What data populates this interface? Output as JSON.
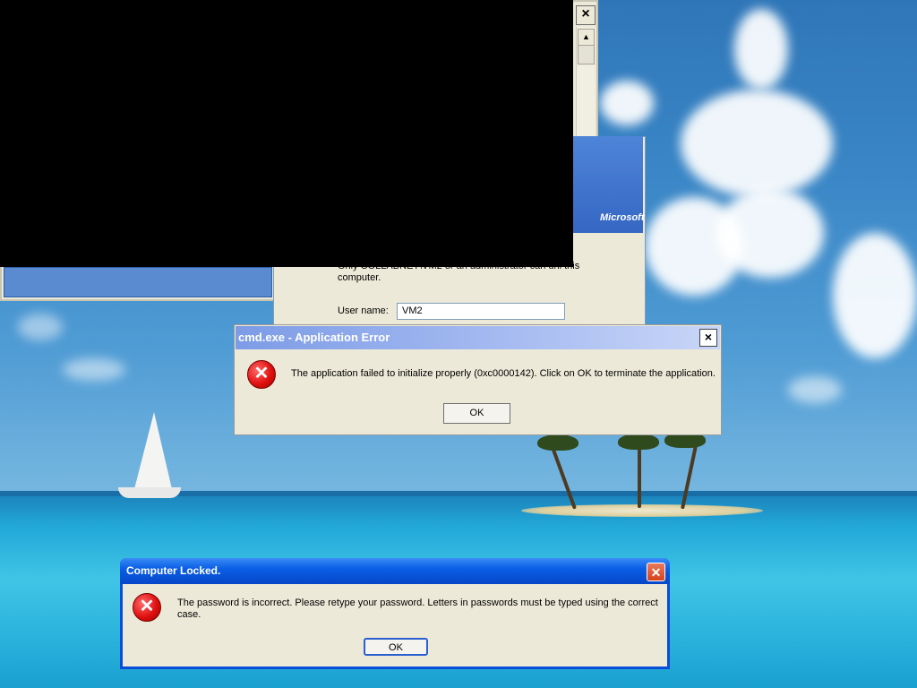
{
  "background_window": {
    "close_glyph": "×",
    "scroll_up": "▲",
    "scroll_down": "▼"
  },
  "logon_dialog": {
    "brand": "Microsoft",
    "message_fragment": "Only COLLABNET\\VM2 or an administrator can unl    this computer.",
    "user_label": "User name:",
    "user_value": "VM2"
  },
  "app_error": {
    "title": "cmd.exe - Application Error",
    "close_glyph": "×",
    "icon_glyph": "✕",
    "message": "The application failed to initialize properly (0xc0000142). Click on OK to terminate the application.",
    "ok_label": "OK"
  },
  "locked_dialog": {
    "title": "Computer Locked.",
    "close_glyph": "✕",
    "icon_glyph": "✕",
    "message": "The password is incorrect.  Please retype your password.  Letters in passwords must be typed using the correct case.",
    "ok_label": "OK"
  },
  "colors": {
    "xp_title_blue": "#0b5fe6",
    "classic_title": "#7d9ce6",
    "dialog_face": "#ece9d8",
    "error_red": "#e01010"
  }
}
